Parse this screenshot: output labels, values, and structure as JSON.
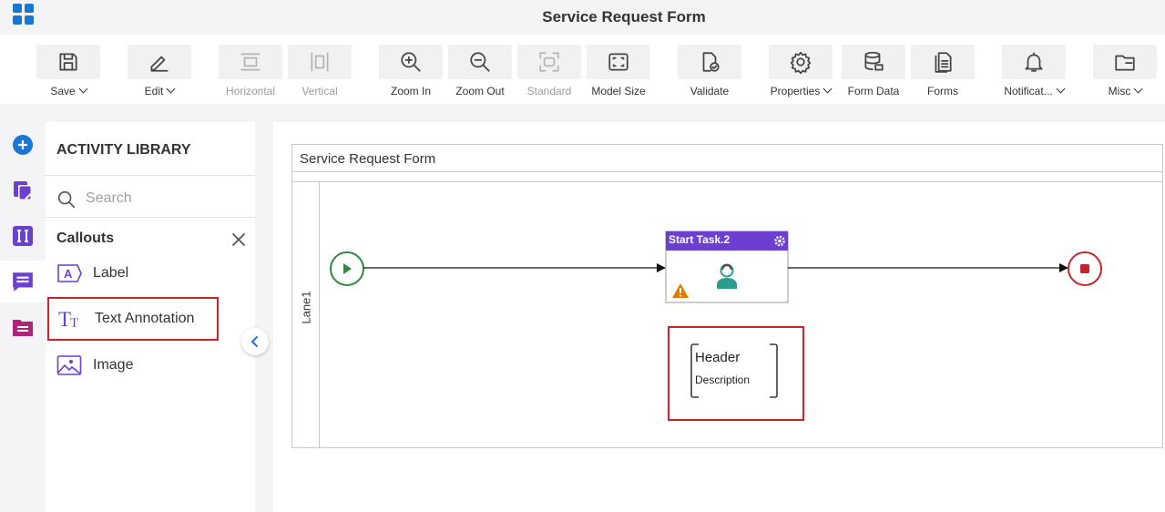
{
  "window": {
    "title": "Service Request Form"
  },
  "toolbar": {
    "save": "Save",
    "edit": "Edit",
    "horizontal": "Horizontal",
    "vertical": "Vertical",
    "zoom_in": "Zoom In",
    "zoom_out": "Zoom Out",
    "standard": "Standard",
    "model_size": "Model Size",
    "validate": "Validate",
    "properties": "Properties",
    "form_data": "Form Data",
    "forms": "Forms",
    "notifications": "Notificat...",
    "misc": "Misc"
  },
  "library": {
    "title": "ACTIVITY LIBRARY",
    "search_placeholder": "Search",
    "section": "Callouts",
    "items": [
      {
        "label": "Label",
        "icon": "label-icon"
      },
      {
        "label": "Text Annotation",
        "icon": "text-annotation-icon"
      },
      {
        "label": "Image",
        "icon": "image-icon"
      }
    ]
  },
  "canvas": {
    "pool_title": "Service Request Form",
    "lane_label": "Lane1",
    "task_title": "Start Task.2",
    "annotation": {
      "header": "Header",
      "description": "Description"
    }
  },
  "colors": {
    "accent": "#1976d2",
    "task_header": "#6b3fd0",
    "start_event": "#2e8b3e",
    "end_event": "#c0272d",
    "highlight": "#d0202a",
    "warning": "#e07b00"
  }
}
